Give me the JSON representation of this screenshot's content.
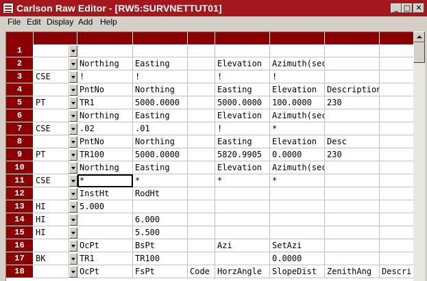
{
  "window": {
    "title": "Carlson Raw Editor - [RW5:SURVNETTUT01]",
    "minimize": "_",
    "maximize": "□",
    "close": "✕"
  },
  "menu": [
    "File",
    "Edit",
    "Display",
    "Add",
    "Help"
  ],
  "colors": {
    "accent": "#8b0000",
    "title_bar": "#a3171d"
  },
  "rows": [
    {
      "num": "1",
      "code": "",
      "cells": [
        "",
        "",
        "",
        "",
        "",
        "",
        ""
      ]
    },
    {
      "num": "2",
      "code": "",
      "cells": [
        "Northing",
        "Easting",
        "",
        "Elevation",
        "Azimuth(sec)",
        "",
        ""
      ]
    },
    {
      "num": "3",
      "code": "CSE",
      "cells": [
        "!",
        "!",
        "",
        "!",
        "!",
        "",
        ""
      ]
    },
    {
      "num": "4",
      "code": "",
      "cells": [
        "PntNo",
        "Northing",
        "",
        "Easting",
        "Elevation",
        "Description",
        ""
      ]
    },
    {
      "num": "5",
      "code": "PT",
      "cells": [
        "TR1",
        "5000.0000",
        "",
        "5000.0000",
        "100.0000",
        "230",
        ""
      ]
    },
    {
      "num": "6",
      "code": "",
      "cells": [
        "Northing",
        "Easting",
        "",
        "Elevation",
        "Azimuth(sec)",
        "",
        ""
      ]
    },
    {
      "num": "7",
      "code": "CSE",
      "cells": [
        ".02",
        ".01",
        "",
        "!",
        "*",
        "",
        ""
      ]
    },
    {
      "num": "8",
      "code": "",
      "cells": [
        "PntNo",
        "Northing",
        "",
        "Easting",
        "Elevation",
        "Desc",
        ""
      ]
    },
    {
      "num": "9",
      "code": "PT",
      "cells": [
        "TR100",
        "5000.0000",
        "",
        "5820.9905",
        "0.0000",
        "230",
        ""
      ]
    },
    {
      "num": "10",
      "code": "",
      "cells": [
        "Northing",
        "Easting",
        "",
        "Elevation",
        "Azimuth(sec)",
        "",
        ""
      ]
    },
    {
      "num": "11",
      "code": "CSE",
      "cells": [
        "*",
        "*",
        "",
        "*",
        "*",
        "",
        ""
      ]
    },
    {
      "num": "12",
      "code": "",
      "cells": [
        "InstHt",
        "RodHt",
        "",
        "",
        "",
        "",
        ""
      ]
    },
    {
      "num": "13",
      "code": "HI",
      "cells": [
        "5.000",
        "",
        "",
        "",
        "",
        "",
        ""
      ]
    },
    {
      "num": "14",
      "code": "HI",
      "cells": [
        "",
        "6.000",
        "",
        "",
        "",
        "",
        ""
      ]
    },
    {
      "num": "15",
      "code": "HI",
      "cells": [
        "",
        "5.500",
        "",
        "",
        "",
        "",
        ""
      ]
    },
    {
      "num": "16",
      "code": "",
      "cells": [
        "OcPt",
        "BsPt",
        "",
        "Azi",
        "SetAzi",
        "",
        ""
      ]
    },
    {
      "num": "17",
      "code": "BK",
      "cells": [
        "TR1",
        "TR100",
        "",
        "",
        "0.0000",
        "",
        ""
      ]
    },
    {
      "num": "18",
      "code": "",
      "cells": [
        "OcPt",
        "FsPt",
        "Code",
        "HorzAngle",
        "SlopeDist",
        "ZenithAng",
        "Descri"
      ]
    }
  ]
}
